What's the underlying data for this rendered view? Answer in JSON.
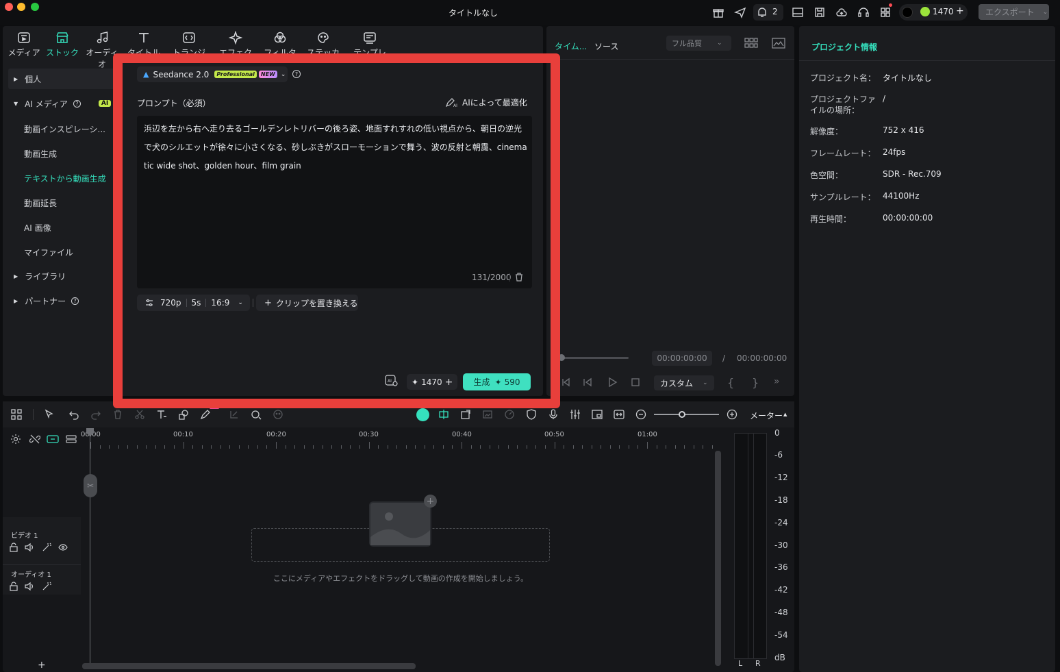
{
  "window": {
    "title": "タイトルなし"
  },
  "titlebar": {
    "badge_count": "2",
    "credits": "1470",
    "export_label": "エクスポート"
  },
  "toolbar": {
    "items": [
      "メディア",
      "ストック",
      "オーディオ",
      "タイトル",
      "トランジション",
      "エフェクト",
      "フィルター",
      "ステッカー",
      "テンプレート"
    ]
  },
  "sidebar": {
    "personal": "個人",
    "ai_media": "AI メディア",
    "ai_badge": "AI",
    "sub_items": [
      "動画インスピレーシ...",
      "動画生成",
      "テキストから動画生成",
      "動画延長",
      "AI 画像",
      "マイファイル"
    ],
    "library": "ライブラリ",
    "partner": "パートナー"
  },
  "modal": {
    "model_name": "Seedance 2.0",
    "badge_pro": "Professional",
    "badge_new": "NEW",
    "prompt_label": "プロンプト（必須）",
    "optimize_label": "AIによって最適化",
    "prompt_text": "浜辺を左から右へ走り去るゴールデンレトリバーの後ろ姿、地面すれすれの低い視点から、朝日の逆光で犬のシルエットが徐々に小さくなる、砂しぶきがスローモーションで舞う、波の反射と朝靄、cinematic wide shot、golden hour、film grain",
    "char_count": "131/2000",
    "resolution": "720p",
    "duration": "5s",
    "ratio": "16:9",
    "replace_clip": "クリップを置き換える",
    "credits": "1470",
    "generate_label": "生成",
    "generate_cost": "590"
  },
  "preview": {
    "tab_timeline": "タイム...",
    "tab_source": "ソース",
    "quality": "フル品質",
    "time_current": "00:00:00:00",
    "time_sep": "/",
    "time_total": "00:00:00:00",
    "zoom": "カスタム"
  },
  "project_info": {
    "title": "プロジェクト情報",
    "rows": [
      {
        "label": "プロジェクト名：",
        "value": "タイトルなし"
      },
      {
        "label": "プロジェクトファイルの場所：",
        "value": "/"
      },
      {
        "label": "解像度：",
        "value": "752 x 416"
      },
      {
        "label": "フレームレート：",
        "value": "24fps"
      },
      {
        "label": "色空間：",
        "value": "SDR - Rec.709"
      },
      {
        "label": "サンプルレート：",
        "value": "44100Hz"
      },
      {
        "label": "再生時間：",
        "value": "00:00:00:00"
      }
    ]
  },
  "timeline": {
    "meter_label": "メーター",
    "ruler": [
      "00:00",
      "00:10",
      "00:20",
      "00:30",
      "00:40",
      "00:50",
      "01:00"
    ],
    "tracks": [
      {
        "name": "ビデオ 1"
      },
      {
        "name": "オーディオ 1"
      }
    ],
    "drop_hint": "ここにメディアやエフェクトをドラッグして動画の作成を開始しましょう。",
    "db_scale": [
      "0",
      "-6",
      "-12",
      "-18",
      "-24",
      "-30",
      "-36",
      "-42",
      "-48",
      "-54",
      "dB"
    ],
    "channels": [
      "L",
      "R"
    ]
  },
  "colors": {
    "accent": "#35e0bd",
    "highlight_border": "#e83f3b",
    "generate_bg": "#3fe0c0"
  }
}
